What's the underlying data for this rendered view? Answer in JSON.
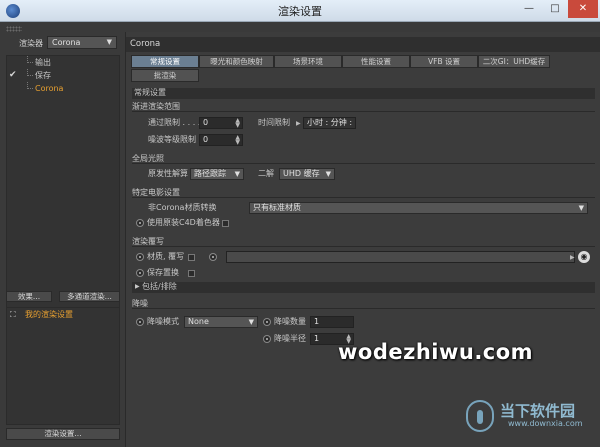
{
  "window": {
    "title": "渲染设置",
    "min_btn": "—",
    "max_btn": "□",
    "close_btn": "✕"
  },
  "left": {
    "renderer_label": "渲染器",
    "renderer_value": "Corona",
    "tree": [
      {
        "label": "输出",
        "checked": false
      },
      {
        "label": "保存",
        "checked": true,
        "check_mark": "✔"
      },
      {
        "label": "Corona",
        "checked": false,
        "active": true
      }
    ],
    "effect_button": "效果...",
    "multipass_button": "多通道渲染...",
    "presets": [
      {
        "label": "我的渲染设置",
        "mark": "⛶"
      }
    ],
    "render_setting_button": "渲染设置..."
  },
  "right": {
    "header": "Corona",
    "tabs": [
      {
        "label": "常规设置",
        "active": true
      },
      {
        "label": "曝光和颜色映射"
      },
      {
        "label": "场景环境"
      },
      {
        "label": "性能设置"
      },
      {
        "label": "VFB 设置"
      },
      {
        "label": "二次GI：UHD缓存"
      },
      {
        "label": "批渲染"
      }
    ],
    "general_section": "常规设置",
    "progressive": {
      "title": "渐进渲染范围",
      "pass_limit_label": "通过限制 . . . .",
      "pass_limit_value": "0",
      "time_limit_label": "时间限制",
      "time_limit_value": "小时 : 分钟 :",
      "noise_limit_label": "噪波等级限制",
      "noise_limit_value": "0"
    },
    "gi": {
      "title": "全局光照",
      "primary_label": "原发性解算",
      "primary_value": "路径跟踪",
      "secondary_label": "二解",
      "secondary_value": "UHD 缓存"
    },
    "special": {
      "title": "特定电影设置",
      "convert_label": "非Corona材质转换",
      "convert_value": "只有标准材质",
      "native_shader_label": "使用原装C4D着色器"
    },
    "override": {
      "title": "渲染覆写",
      "material_label": "材质, 覆写",
      "keep_label": "保存置换"
    },
    "include_exclude": "包括/排除",
    "denoise": {
      "title": "降噪",
      "mode_label": "降噪模式",
      "mode_value": "None",
      "amount_label": "降噪数量",
      "amount_value": "1",
      "radius_label": "降噪半径",
      "radius_value": "1"
    }
  },
  "watermark": {
    "text": "wodezhiwu.com",
    "cn": "当下软件园",
    "url": "www.downxia.com"
  },
  "colors": {
    "accent_orange": "#e8a030",
    "active_tab": "#6b7f92",
    "panel_bg": "#3c3c3c"
  }
}
